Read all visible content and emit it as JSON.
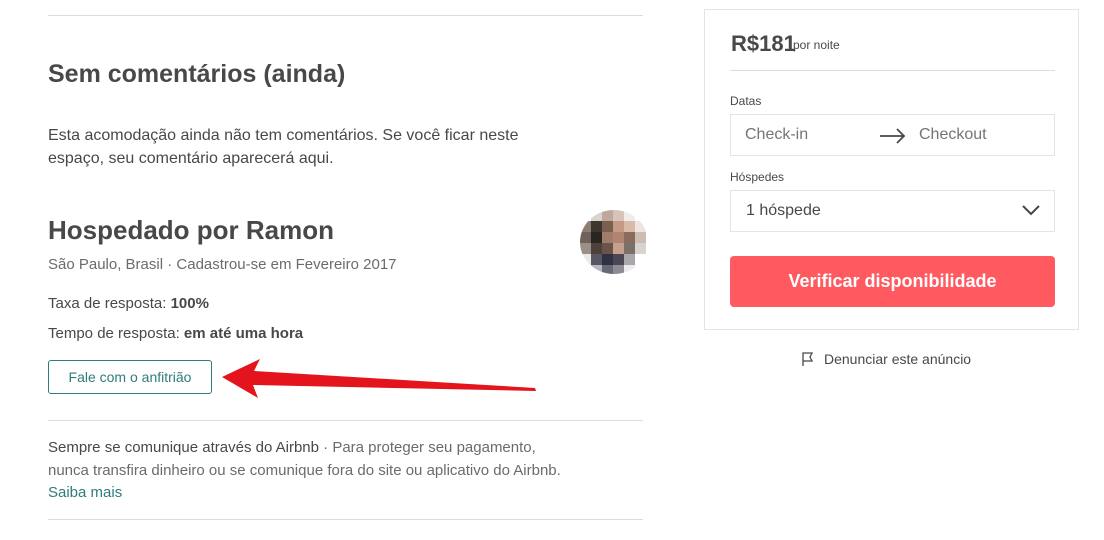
{
  "reviews": {
    "title": "Sem comentários (ainda)",
    "body_line1": "Esta acomodação ainda não tem comentários. Se você ficar neste",
    "body_line2": "espaço, seu comentário aparecerá aqui."
  },
  "host": {
    "title": "Hospedado por Ramon",
    "meta": "São Paulo, Brasil · Cadastrou-se em Fevereiro 2017",
    "response_rate_label": "Taxa de resposta: ",
    "response_rate_value": "100%",
    "response_time_label": "Tempo de resposta: ",
    "response_time_value": "em até uma hora",
    "contact_button": "Fale com o anfitrião",
    "avatar_icon": "pixelated-avatar"
  },
  "notice": {
    "bold": "Sempre se comunique através do Airbnb",
    "text1": " · Para proteger seu pagamento,",
    "text2": "nunca transfira dinheiro ou se comunique fora do site ou aplicativo do Airbnb.",
    "link": "Saiba mais"
  },
  "booking": {
    "price": "R$181",
    "per_night": "por noite",
    "dates_label": "Datas",
    "checkin_placeholder": "Check-in",
    "checkout_placeholder": "Checkout",
    "guests_label": "Hóspedes",
    "guests_value": "1 hóspede",
    "check_button": "Verificar disponibilidade"
  },
  "report": {
    "label": "Denunciar este anúncio",
    "icon": "flag-icon"
  },
  "colors": {
    "primary": "#ff5a5f",
    "teal": "#2e7d7b",
    "text": "#484848",
    "annotation": "#e3141b"
  }
}
